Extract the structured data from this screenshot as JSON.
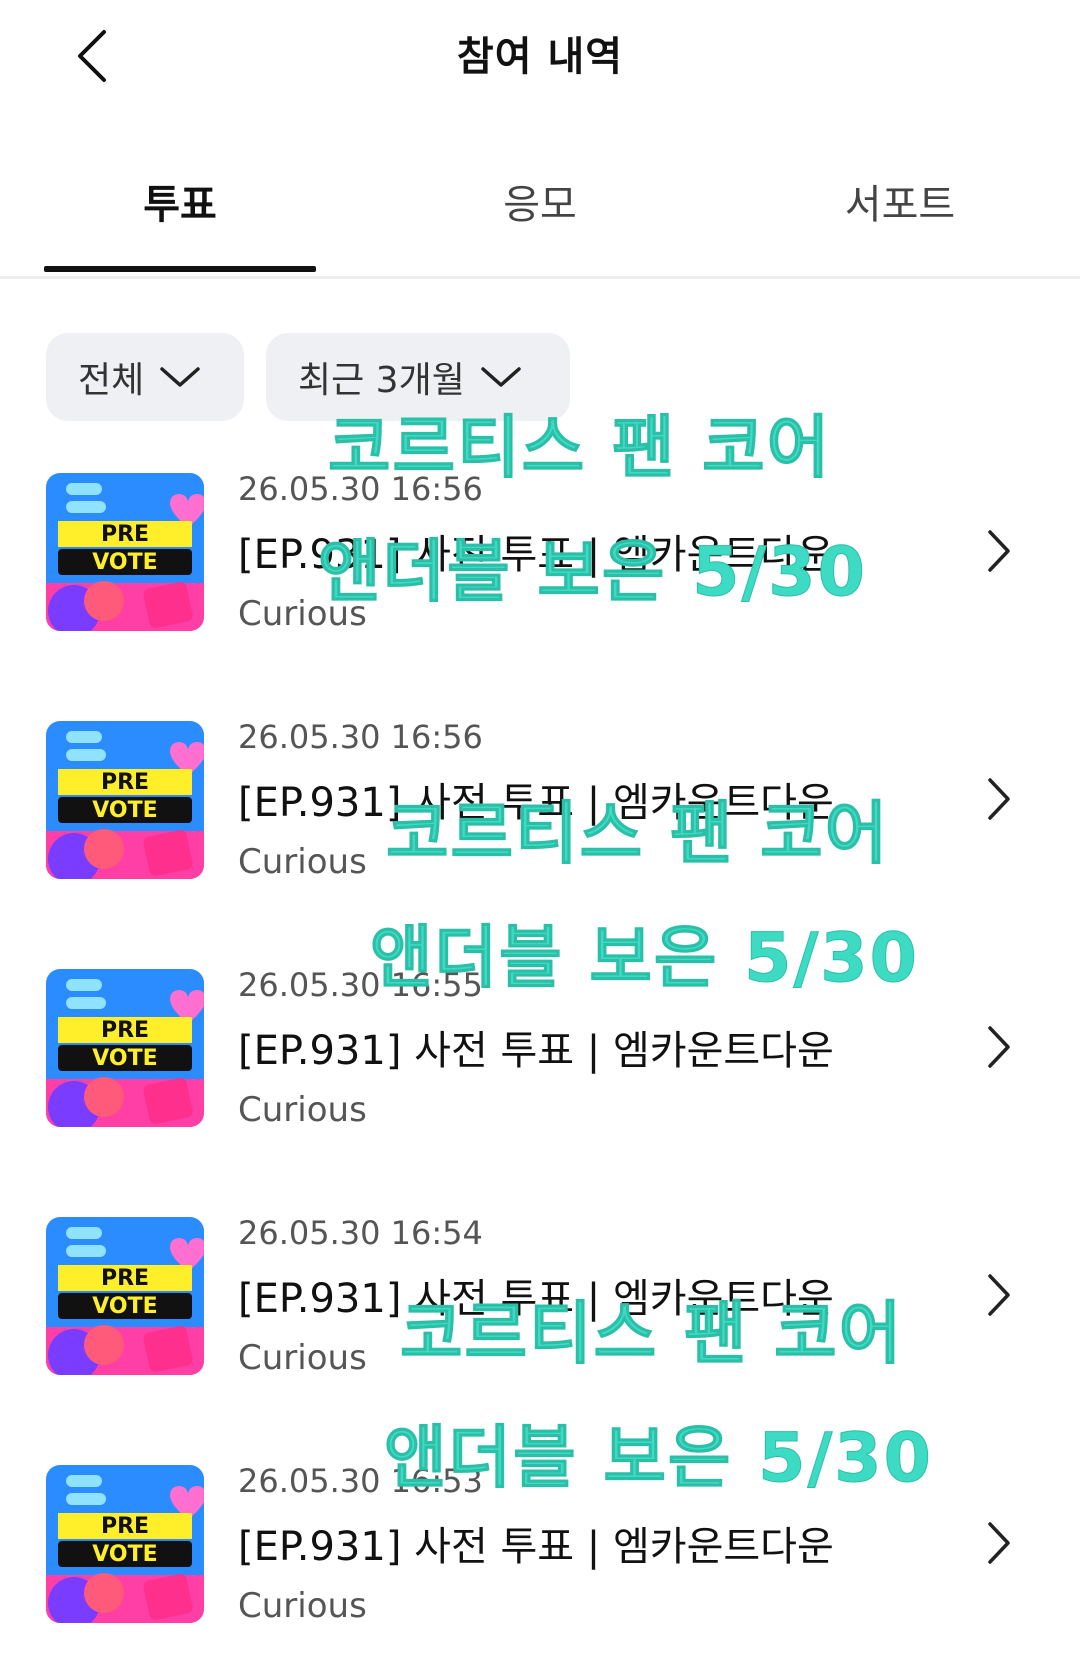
{
  "header": {
    "title": "참여 내역"
  },
  "tabs": [
    {
      "label": "투표",
      "active": true
    },
    {
      "label": "응모",
      "active": false
    },
    {
      "label": "서포트",
      "active": false
    }
  ],
  "filters": {
    "category": "전체",
    "period": "최근 3개월"
  },
  "items": [
    {
      "date": "26.05.30 16:56",
      "title": "[EP.931] 사전 투표 | 엠카운트다운",
      "subtitle": "Curious",
      "badge_top": "PRE",
      "badge_bottom": "VOTE"
    },
    {
      "date": "26.05.30 16:56",
      "title": "[EP.931] 사전 투표 | 엠카운트다운",
      "subtitle": "Curious",
      "badge_top": "PRE",
      "badge_bottom": "VOTE"
    },
    {
      "date": "26.05.30 16:55",
      "title": "[EP.931] 사전 투표 | 엠카운트다운",
      "subtitle": "Curious",
      "badge_top": "PRE",
      "badge_bottom": "VOTE"
    },
    {
      "date": "26.05.30 16:54",
      "title": "[EP.931] 사전 투표 | 엠카운트다운",
      "subtitle": "Curious",
      "badge_top": "PRE",
      "badge_bottom": "VOTE"
    },
    {
      "date": "26.05.30 16:53",
      "title": "[EP.931] 사전 투표 | 엠카운트다운",
      "subtitle": "Curious",
      "badge_top": "PRE",
      "badge_bottom": "VOTE"
    }
  ],
  "watermarks": [
    {
      "line1": "코르티스 팬 코어",
      "line2": "앤더블 보은 5/30"
    },
    {
      "line1": "코르티스 팬 코어",
      "line2": "앤더블 보은 5/30"
    },
    {
      "line1": "코르티스 팬 코어",
      "line2": "앤더블 보은 5/30"
    }
  ],
  "colors": {
    "watermark": "#3ddbc3",
    "filter_bg": "#eef0f3",
    "text": "#111111"
  }
}
